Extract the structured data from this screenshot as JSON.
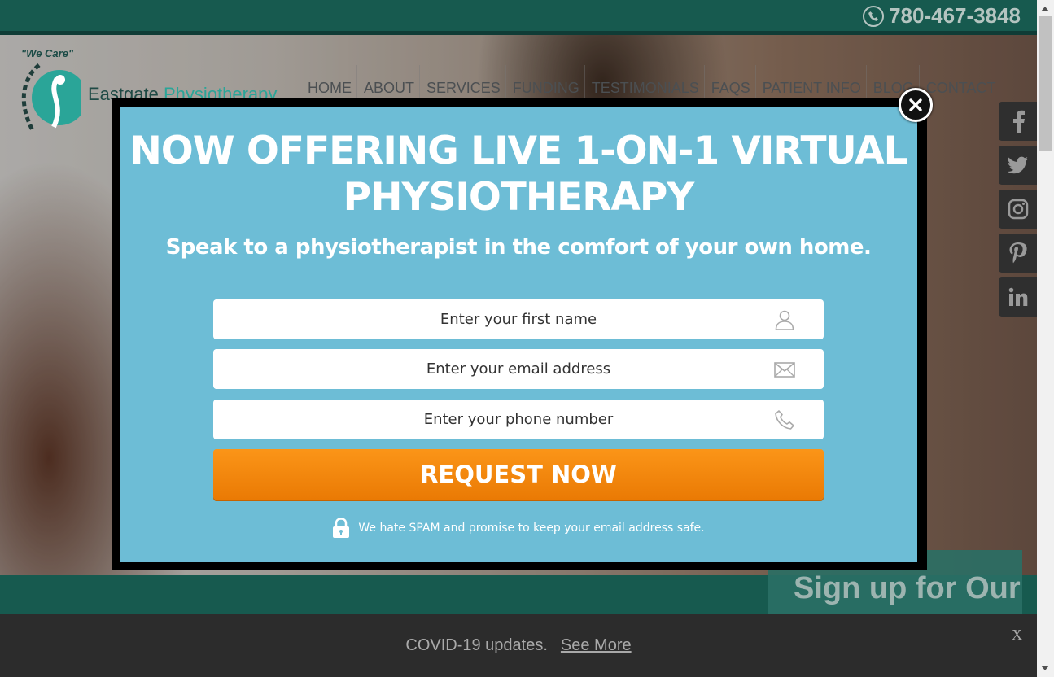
{
  "header": {
    "phone": "780-467-3848",
    "phone_icon": "phone-icon"
  },
  "logo": {
    "tagline": "\"We Care\"",
    "name_part1": "Eastgate ",
    "name_part2": "Physiotherapy"
  },
  "nav": {
    "items": [
      "HOME",
      "ABOUT",
      "SERVICES",
      "FUNDING",
      "TESTIMONIALS",
      "FAQS",
      "PATIENT INFO",
      "BLOG",
      "CONTACT"
    ]
  },
  "social": [
    "facebook-icon",
    "twitter-icon",
    "instagram-icon",
    "pinterest-icon",
    "linkedin-icon"
  ],
  "modal": {
    "title_line1": "NOW OFFERING LIVE 1-ON-1 VIRTUAL",
    "title_line2": "PHYSIOTHERAPY",
    "subtitle": "Speak to a physiotherapist in the comfort of your own home.",
    "fields": {
      "first_name_placeholder": "Enter your first name",
      "email_placeholder": "Enter your email address",
      "phone_placeholder": "Enter your phone number"
    },
    "button": "REQUEST NOW",
    "spam_note": "We hate SPAM and promise to keep your email address safe.",
    "close_label": "x"
  },
  "signup": {
    "text": "Sign up for Our"
  },
  "covid": {
    "text": "COVID-19 updates.",
    "link": "See More",
    "close": "X"
  },
  "colors": {
    "top_bar": "#175a4f",
    "modal_bg": "#6dbdd6",
    "button": "#f28a0e",
    "covid_bar": "#2c2c2c"
  }
}
